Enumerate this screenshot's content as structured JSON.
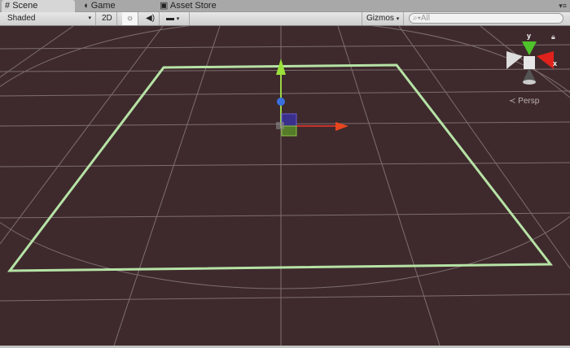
{
  "tabs": [
    {
      "label": "Scene",
      "icon": "grid-icon"
    },
    {
      "label": "Game",
      "icon": "pacman-icon"
    },
    {
      "label": "Asset Store",
      "icon": "shopping-bag-icon"
    }
  ],
  "toolbar": {
    "shading": "Shaded",
    "mode_2d": "2D",
    "lighting_icon": "sun-icon",
    "audio_icon": "speaker-icon",
    "effects_icon": "image-icon",
    "gizmos": "Gizmos",
    "search_placeholder": "All"
  },
  "scene": {
    "projection": "Persp",
    "axis_x": "x",
    "axis_y": "y",
    "background": "#3e2a2c",
    "plane_outline": "#b6e3a6"
  }
}
